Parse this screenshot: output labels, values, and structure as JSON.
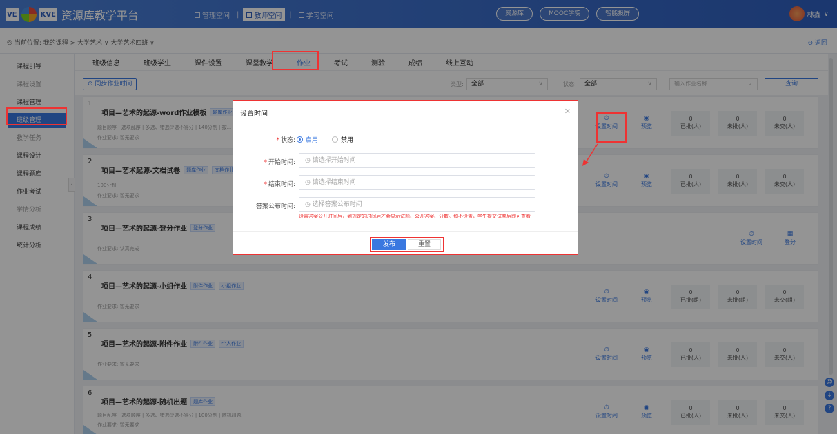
{
  "header": {
    "logo_mark1": "VE",
    "logo_mark2": "KVE",
    "title": "资源库教学平台",
    "spaces": [
      "管理空间",
      "教师空间",
      "学习空间"
    ],
    "pills": [
      "资源库",
      "MOOC学院",
      "智能投屏"
    ],
    "user_name": "林鑫"
  },
  "breadcrumb": {
    "text": "当前位置: 我的课程 > 大学艺术 ∨  大学艺术四班 ∨",
    "back": "返回"
  },
  "sidebar": {
    "items": [
      "课程引导",
      "课程设置",
      "课程管理",
      "班级管理",
      "教学任务",
      "课程设计",
      "课程题库",
      "作业考试",
      "学情分析",
      "课程成绩",
      "统计分析"
    ]
  },
  "tabs": [
    "班级信息",
    "班级学生",
    "课件设置",
    "课堂教学",
    "作业",
    "考试",
    "测验",
    "成绩",
    "线上互动"
  ],
  "filter": {
    "sync_button": "同步作业时间",
    "type_label": "类型:",
    "type_value": "全部",
    "status_label": "状态:",
    "status_value": "全部",
    "search_placeholder": "输入作业名称",
    "query_button": "查询"
  },
  "actions": {
    "set_time": "设置时间",
    "preview": "预览",
    "grade": "登分"
  },
  "assignments": [
    {
      "num": "1",
      "title": "项目—艺术的起源-word作业模板",
      "tags": [
        "题库作业"
      ],
      "meta1": "题目顺序 | 选项乱序 | 多选、错选少选不得分 | 140分制 | 按...",
      "meta2": "作业要求: 暂无要求",
      "stats": [
        [
          "0",
          "已批(人)"
        ],
        [
          "0",
          "未批(人)"
        ],
        [
          "0",
          "未交(人)"
        ]
      ]
    },
    {
      "num": "2",
      "title": "项目—艺术起源-文档试卷",
      "tags": [
        "题库作业",
        "文档作业"
      ],
      "meta1": "100分制",
      "meta2": "作业要求: 暂无要求",
      "stats": [
        [
          "0",
          "已批(人)"
        ],
        [
          "0",
          "未批(人)"
        ],
        [
          "0",
          "未交(人)"
        ]
      ]
    },
    {
      "num": "3",
      "title": "项目—艺术的起源-登分作业",
      "tags": [
        "登分作业"
      ],
      "meta1": "",
      "meta2": "作业要求: 认真完成",
      "stats": []
    },
    {
      "num": "4",
      "title": "项目—艺术的起源-小组作业",
      "tags": [
        "附件作业",
        "小组作业"
      ],
      "meta1": "",
      "meta2": "作业要求: 暂无要求",
      "stats": [
        [
          "0",
          "已批(组)"
        ],
        [
          "0",
          "未批(组)"
        ],
        [
          "0",
          "未交(组)"
        ]
      ]
    },
    {
      "num": "5",
      "title": "项目—艺术的起源-附件作业",
      "tags": [
        "附件作业",
        "个人作业"
      ],
      "meta1": "",
      "meta2": "作业要求: 暂无要求",
      "stats": [
        [
          "0",
          "已批(人)"
        ],
        [
          "0",
          "未批(人)"
        ],
        [
          "0",
          "未交(人)"
        ]
      ]
    },
    {
      "num": "6",
      "title": "项目—艺术的起源-随机出题",
      "tags": [
        "题库作业"
      ],
      "meta1": "题目乱序 | 选项顺序 | 多选、错选少选不得分 | 100分制 | 随机出题",
      "meta2": "作业要求: 暂无要求",
      "stats": [
        [
          "0",
          "已批(人)"
        ],
        [
          "0",
          "未批(人)"
        ],
        [
          "0",
          "未交(人)"
        ]
      ]
    }
  ],
  "modal": {
    "title": "设置时间",
    "status_label": "状态:",
    "enable": "启用",
    "disable": "禁用",
    "start_label": "开始时间:",
    "start_placeholder": "请选择开始时间",
    "end_label": "结束时间:",
    "end_placeholder": "请选择结束时间",
    "answer_label": "答案公布时间:",
    "answer_placeholder": "选择答案公布时间",
    "hint": "设置答案公开时间后，到规定的时间后才会显示试题、公开答案、分数。如不设置，学生提交试卷后即可查看",
    "publish": "发布",
    "reset": "重置"
  },
  "colors": {
    "primary": "#3a78e0",
    "highlight": "#e33333"
  }
}
